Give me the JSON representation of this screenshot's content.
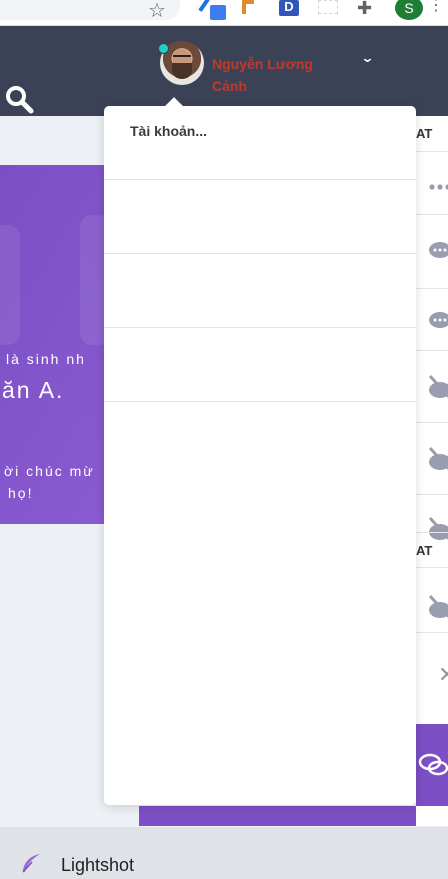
{
  "browser": {
    "profile_initial": "S",
    "extension_d_label": "D"
  },
  "header": {
    "user_name": "Nguyễn Lương Cảnh",
    "chevron": "⌄"
  },
  "banner": {
    "line1": "là sinh nh",
    "line2": "ăn A.",
    "line3": "ời chúc mừ",
    "line4": "họ!"
  },
  "dropdown": {
    "account_label": "Tài khoản..."
  },
  "right_panel": {
    "head1": "AT",
    "head2": "AT"
  },
  "taskbar": {
    "app_label": "Lightshot"
  },
  "colors": {
    "navbar": "#3c4256",
    "accent_purple": "#7c4fc4",
    "user_name": "#c0392b",
    "online": "#1fd1c4"
  }
}
